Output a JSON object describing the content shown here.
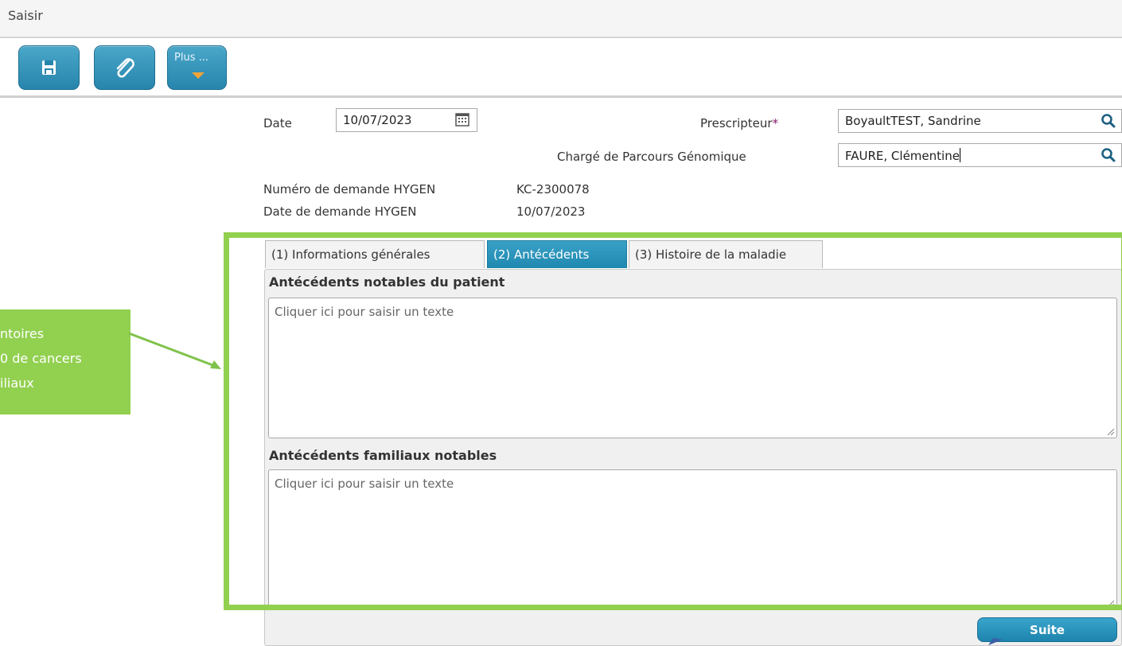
{
  "header": {
    "title": "Saisir"
  },
  "toolbar": {
    "save_icon": "floppy-disk-icon",
    "attach_icon": "paperclip-icon",
    "more_label": "Plus ..."
  },
  "form": {
    "date_label": "Date",
    "date_value": "10/07/2023",
    "prescripteur_label": "Prescripteur",
    "required_mark": "*",
    "prescripteur_value": "BoyaultTEST, Sandrine",
    "charge_label": "Chargé de Parcours Génomique",
    "charge_value": "FAURE, Clémentine",
    "numero_label": "Numéro de demande HYGEN",
    "numero_value": "KC-2300078",
    "date_demande_label": "Date de demande HYGEN",
    "date_demande_value": "10/07/2023"
  },
  "callout": {
    "lines": [
      "ntoires",
      "0 de cancers",
      "iliaux"
    ],
    "bg_color": "#92d050"
  },
  "tabs": [
    {
      "label": "(1) Informations générales",
      "active": false
    },
    {
      "label": "(2) Antécédents",
      "active": true
    },
    {
      "label": "(3) Histoire de la maladie",
      "active": false
    }
  ],
  "sections": {
    "patient_title": "Antécédents notables du patient",
    "patient_placeholder": "Cliquer ici pour saisir un texte",
    "familiaux_title": "Antécédents familiaux notables",
    "familiaux_placeholder": "Cliquer ici pour saisir un texte"
  },
  "footer": {
    "suite_label": "Suite"
  },
  "colors": {
    "accent": "#2a8bb3",
    "highlight_frame": "#92d050",
    "required": "#8b1a6b"
  }
}
